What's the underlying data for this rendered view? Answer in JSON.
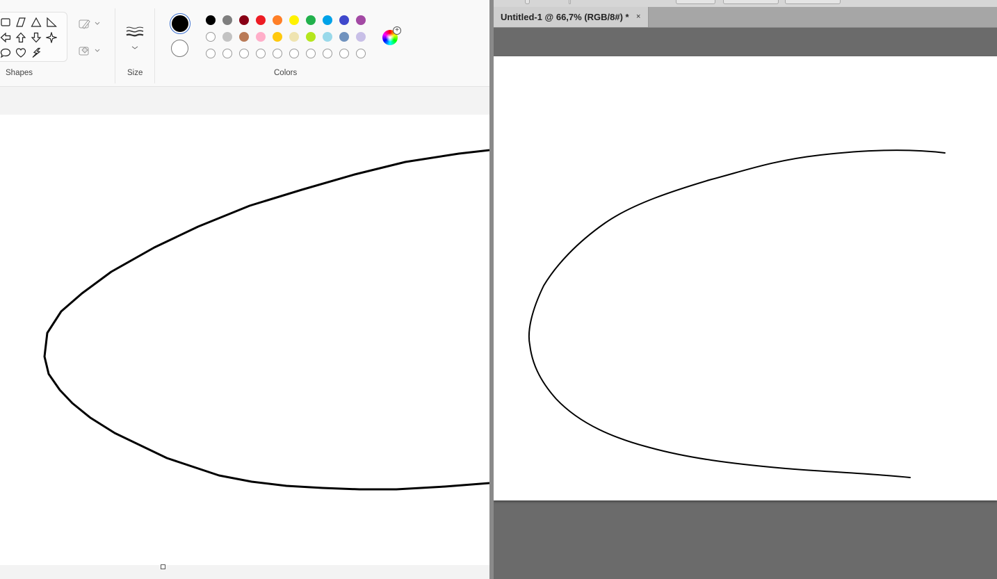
{
  "paint": {
    "groups": {
      "shapes": "Shapes",
      "size": "Size",
      "colors": "Colors"
    },
    "shape_icons": [
      "rectangle-icon",
      "parallelogram-icon",
      "triangle-icon",
      "right-triangle-icon",
      "arrow-left-icon",
      "arrow-up-icon",
      "arrow-down-icon",
      "four-point-star-icon",
      "speech-bubble-icon",
      "heart-icon",
      "lightning-icon"
    ],
    "palette_row1": [
      "#000000",
      "#7f7f7f",
      "#880015",
      "#ed1c24",
      "#ff7f27",
      "#fff200",
      "#22b14c",
      "#00a2e8",
      "#3f48cc",
      "#a349a4"
    ],
    "palette_row2": [
      "#ffffff",
      "#c3c3c3",
      "#b97a57",
      "#ffaec9",
      "#ffc90e",
      "#efe4b0",
      "#b5e61d",
      "#99d9ea",
      "#7092be",
      "#c8bfe7"
    ],
    "primary_color": "#000000",
    "secondary_color": "#ffffff"
  },
  "photoshop": {
    "tab_title": "Untitled-1 @ 66,7% (RGB/8#) *",
    "tab_close": "×"
  }
}
